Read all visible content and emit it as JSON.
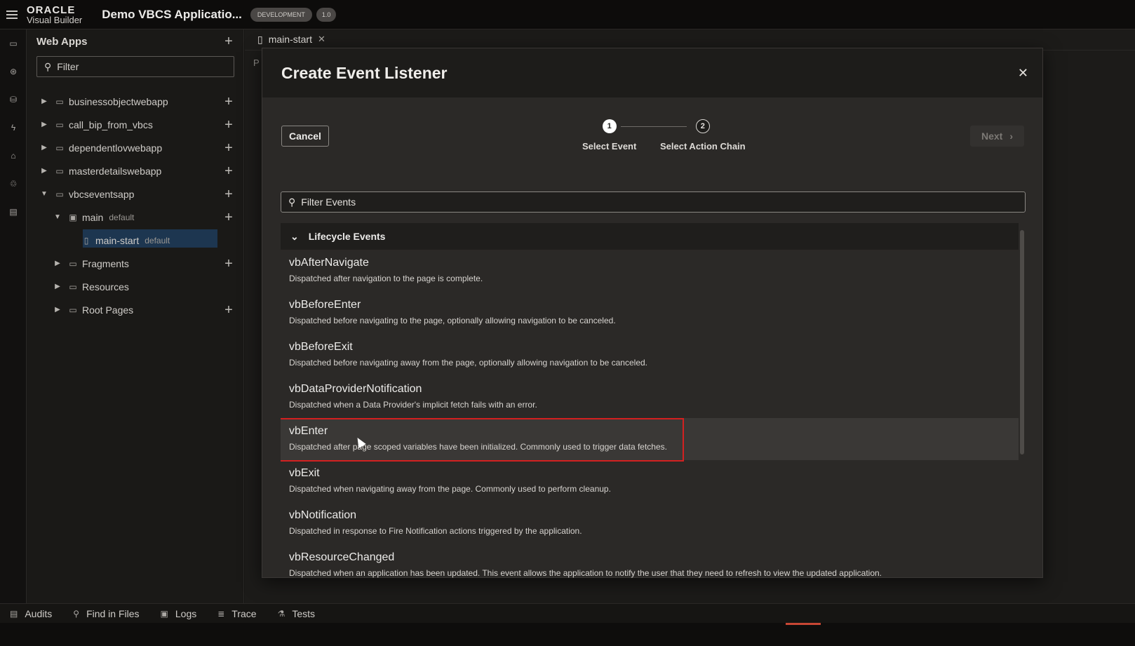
{
  "header": {
    "brand_top": "ORACLE",
    "brand_bottom": "Visual Builder",
    "app_title": "Demo VBCS Applicatio...",
    "env_badge": "DEVELOPMENT",
    "version_badge": "1.0"
  },
  "rail": {
    "icons": [
      "web-apps-icon",
      "services-icon",
      "business-objects-icon",
      "processes-icon",
      "components-icon",
      "layouts-icon",
      "source-icon"
    ]
  },
  "navigator": {
    "title": "Web Apps",
    "filter_placeholder": "Filter",
    "items": [
      {
        "label": "businessobjectwebapp"
      },
      {
        "label": "call_bip_from_vbcs"
      },
      {
        "label": "dependentlovwebapp"
      },
      {
        "label": "masterdetailswebapp"
      },
      {
        "label": "vbcseventsapp"
      },
      {
        "label": "main",
        "tag": "default"
      },
      {
        "label": "main-start",
        "tag": "default"
      },
      {
        "label": "Fragments"
      },
      {
        "label": "Resources"
      },
      {
        "label": "Root Pages"
      }
    ]
  },
  "editor": {
    "tab_label": "main-start",
    "subtab_label": "P"
  },
  "dialog": {
    "title": "Create Event Listener",
    "cancel_label": "Cancel",
    "next_label": "Next",
    "steps": [
      {
        "number": "1",
        "label": "Select Event"
      },
      {
        "number": "2",
        "label": "Select Action Chain"
      }
    ],
    "filter_placeholder": "Filter Events",
    "group_title": "Lifecycle Events",
    "events": [
      {
        "name": "vbAfterNavigate",
        "description": "Dispatched after navigation to the page is complete."
      },
      {
        "name": "vbBeforeEnter",
        "description": "Dispatched before navigating to the page, optionally allowing navigation to be canceled."
      },
      {
        "name": "vbBeforeExit",
        "description": "Dispatched before navigating away from the page, optionally allowing navigation to be canceled."
      },
      {
        "name": "vbDataProviderNotification",
        "description": "Dispatched when a Data Provider's implicit fetch fails with an error."
      },
      {
        "name": "vbEnter",
        "description": "Dispatched after page scoped variables have been initialized. Commonly used to trigger data fetches."
      },
      {
        "name": "vbExit",
        "description": "Dispatched when navigating away from the page. Commonly used to perform cleanup."
      },
      {
        "name": "vbNotification",
        "description": "Dispatched in response to Fire Notification actions triggered by the application."
      },
      {
        "name": "vbResourceChanged",
        "description": "Dispatched when an application has been updated. This event allows the application to notify the user that they need to refresh to view the updated application."
      }
    ],
    "highlighted_event": "vbEnter"
  },
  "bottombar": {
    "items": [
      "Audits",
      "Find in Files",
      "Logs",
      "Trace",
      "Tests"
    ]
  },
  "colors": {
    "accent_red": "#d32020",
    "selection_blue": "#1d3650",
    "oracle_red": "#c74634"
  }
}
